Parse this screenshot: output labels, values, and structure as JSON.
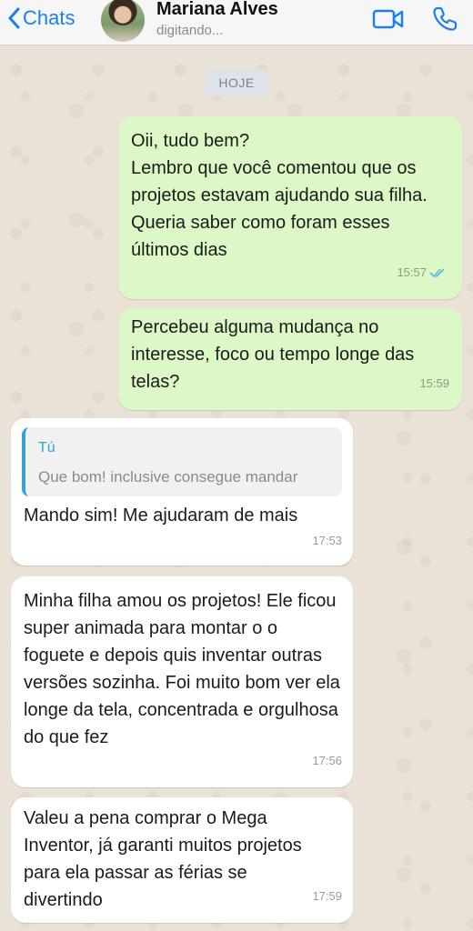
{
  "header": {
    "back_label": "Chats",
    "contact_name": "Mariana Alves",
    "contact_status": "digitando..."
  },
  "date_separator": "HOJE",
  "messages": [
    {
      "direction": "out",
      "text": "Oii, tudo bem?\nLembro que você comentou que os projetos estavam ajudando sua filha. Queria saber como foram esses últimos dias",
      "time": "15:57",
      "status": "read"
    },
    {
      "direction": "out",
      "text": "Percebeu alguma mudança no interesse, foco ou tempo longe das telas?",
      "time": "15:59"
    },
    {
      "direction": "in",
      "quote": {
        "author": "Tú",
        "text": "Que bom! inclusive consegue mandar"
      },
      "text": "Mando sim! Me ajudaram de mais",
      "time": "17:53"
    },
    {
      "direction": "in",
      "text": "Minha filha amou os projetos! Ele ficou super animada para montar o o foguete e depois quis inventar outras versões sozinha. Foi muito bom ver ela longe da tela, concentrada e orgulhosa do que fez",
      "time": "17:56"
    },
    {
      "direction": "in",
      "text": "Valeu a pena comprar o Mega Inventor, já garanti muitos projetos para ela passar as férias se divertindo",
      "time": "17:59"
    }
  ],
  "colors": {
    "accent": "#1a7ff0",
    "outgoing_bubble": "#dcf8c6",
    "incoming_bubble": "#ffffff",
    "read_ticks": "#4fb6ec"
  }
}
